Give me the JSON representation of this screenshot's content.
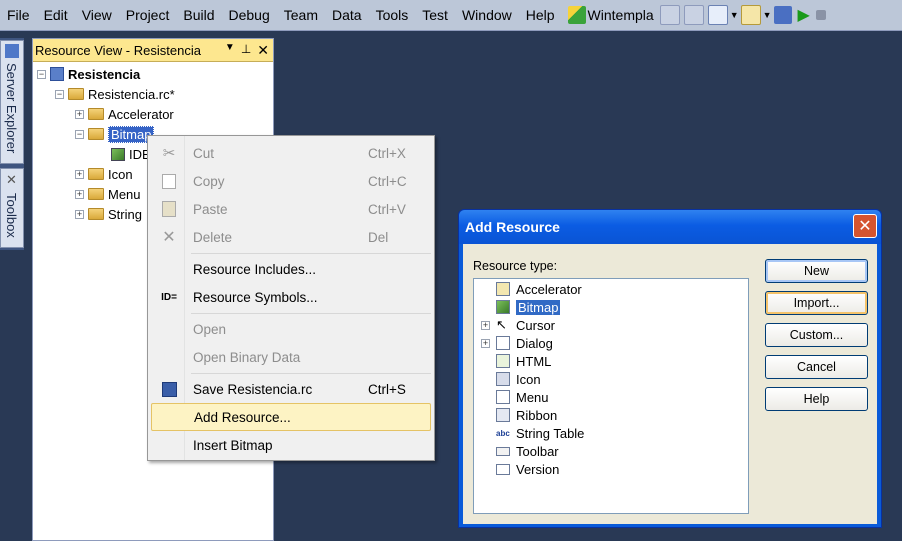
{
  "menubar": {
    "items": [
      "File",
      "Edit",
      "View",
      "Project",
      "Build",
      "Debug",
      "Team",
      "Data",
      "Tools",
      "Test",
      "Window",
      "Help"
    ],
    "config_combo": "Wintempla"
  },
  "dock": {
    "server_explorer": "Server Explorer",
    "toolbox": "Toolbox"
  },
  "resource_view": {
    "title": "Resource View - Resistencia",
    "tree": {
      "root": "Resistencia",
      "rc": "Resistencia.rc*",
      "accelerator": "Accelerator",
      "bitmap": "Bitmap",
      "bitmap_child": "IDB",
      "icon": "Icon",
      "menu": "Menu",
      "string": "String"
    }
  },
  "context_menu": {
    "cut": "Cut",
    "cut_sc": "Ctrl+X",
    "copy": "Copy",
    "copy_sc": "Ctrl+C",
    "paste": "Paste",
    "paste_sc": "Ctrl+V",
    "delete": "Delete",
    "delete_sc": "Del",
    "resource_includes": "Resource Includes...",
    "resource_symbols": "Resource Symbols...",
    "symbols_icon_text": "ID=",
    "open": "Open",
    "open_binary": "Open Binary Data",
    "save": "Save Resistencia.rc",
    "save_sc": "Ctrl+S",
    "add_resource": "Add Resource...",
    "insert_bitmap": "Insert Bitmap"
  },
  "dialog": {
    "title": "Add Resource",
    "resource_type_label": "Resource type:",
    "types": [
      "Accelerator",
      "Bitmap",
      "Cursor",
      "Dialog",
      "HTML",
      "Icon",
      "Menu",
      "Ribbon",
      "String Table",
      "Toolbar",
      "Version"
    ],
    "selected_type": "Bitmap",
    "buttons": {
      "new": "New",
      "import": "Import...",
      "custom": "Custom...",
      "cancel": "Cancel",
      "help": "Help"
    }
  }
}
